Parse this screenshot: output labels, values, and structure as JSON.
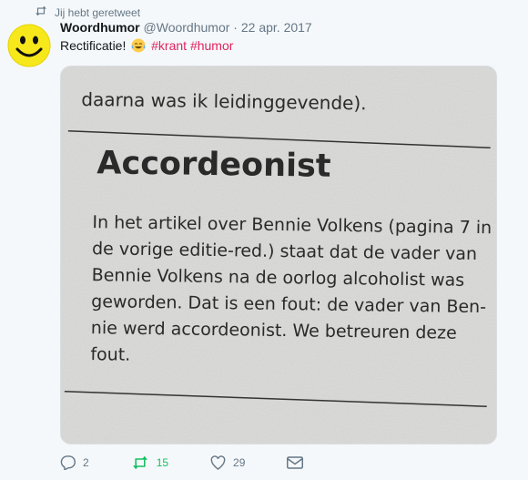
{
  "retweet_notice": {
    "icon": "retweet-icon",
    "text": "Jij hebt geretweet"
  },
  "tweet": {
    "avatar_icon": "smiley-face-icon",
    "name": "Woordhumor",
    "handle": "@Woordhumor",
    "separator": "·",
    "date": "22 apr. 2017",
    "text": "Rectificatie!",
    "emoji": "tears-of-joy-emoji",
    "hashtags": [
      "#krant",
      "#humor"
    ],
    "hashtag_color": "#e0245e"
  },
  "clipping": {
    "top_line": "daarna was ik leidinggevende).",
    "headline": "Accordeonist",
    "body_lines": [
      "In het artikel over Bennie Volkens (pagina 7 in",
      "de vorige editie-red.) staat dat de vader van",
      "Bennie Volkens na de oorlog alcoholist was",
      "geworden. Dat is een fout: de vader van Ben-",
      "nie werd accordeonist. We betreuren deze",
      "fout."
    ]
  },
  "actions": {
    "reply": {
      "icon": "reply-icon",
      "count": "2"
    },
    "retweet": {
      "icon": "retweet-icon",
      "count": "15",
      "active": true,
      "color": "#17bf63"
    },
    "like": {
      "icon": "heart-icon",
      "count": "29"
    },
    "dm": {
      "icon": "envelope-icon"
    }
  }
}
